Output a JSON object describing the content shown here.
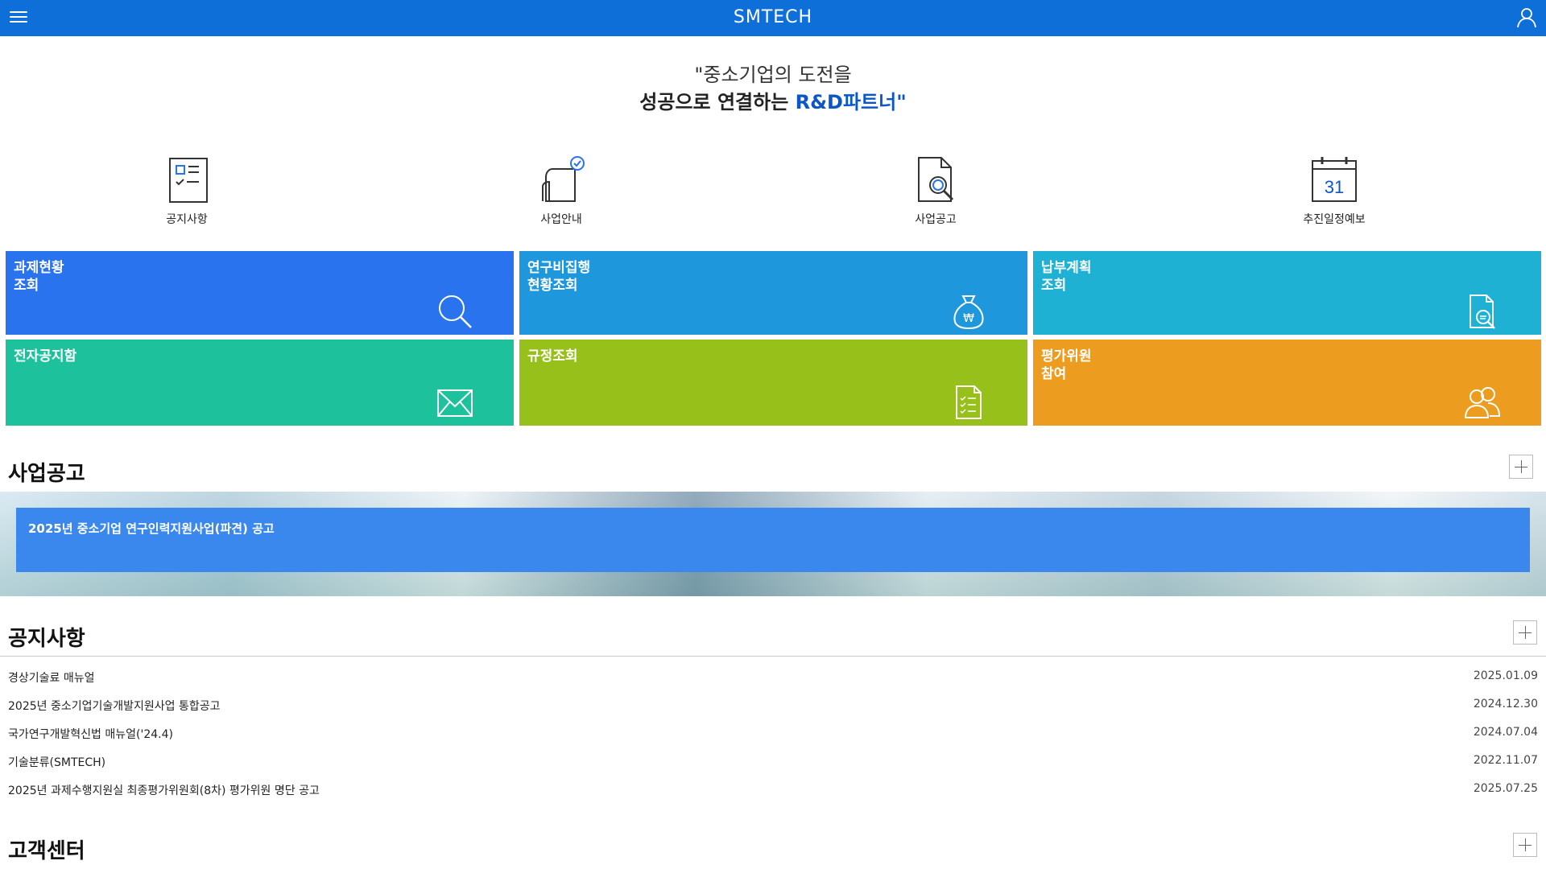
{
  "header": {
    "title": "SMTECH",
    "menu_icon": "hamburger-menu-icon",
    "user_icon": "user-icon",
    "bg_color": "#0f6fd9"
  },
  "slogan": {
    "line1": "\"중소기업의 도전을",
    "line2_prefix": "성공으로 연결하는 ",
    "line2_accent": "R&D파트너\"",
    "accent_color": "#0b57c7"
  },
  "quick_menu": [
    {
      "label": "공지사항",
      "icon": "checklist-icon"
    },
    {
      "label": "사업안내",
      "icon": "tablet-check-icon"
    },
    {
      "label": "사업공고",
      "icon": "document-search-icon"
    },
    {
      "label": "추진일정예보",
      "icon": "calendar-icon",
      "icon_text": "31"
    }
  ],
  "tiles": [
    {
      "label": "과제현황\n조회",
      "icon": "search-icon",
      "color": "#2a73ee"
    },
    {
      "label": "연구비집행\n현황조회",
      "icon": "money-bag-icon",
      "color": "#1f97dc"
    },
    {
      "label": "납부계획\n조회",
      "icon": "document-search-icon",
      "color": "#1eb1d4"
    },
    {
      "label": "전자공지함",
      "icon": "mail-icon",
      "color": "#1dc29d"
    },
    {
      "label": "규정조회",
      "icon": "checklist-document-icon",
      "color": "#97c11a"
    },
    {
      "label": "평가위원\n참여",
      "icon": "people-icon",
      "color": "#ec9c1f"
    }
  ],
  "business_notice": {
    "title": "사업공고",
    "items": [
      "2025년 중소기업 연구인력지원사업(파견) 공고"
    ]
  },
  "notices": {
    "title": "공지사항",
    "items": [
      {
        "title": "경상기술료 매뉴얼",
        "date": "2025.01.09"
      },
      {
        "title": "2025년 중소기업기술개발지원사업 통합공고",
        "date": "2024.12.30"
      },
      {
        "title": "국가연구개발혁신법 매뉴얼('24.4)",
        "date": "2024.07.04"
      },
      {
        "title": "기술분류(SMTECH)",
        "date": "2022.11.07"
      },
      {
        "title": "2025년 과제수행지원실 최종평가위원회(8차) 평가위원 명단 공고",
        "date": "2025.07.25"
      }
    ]
  },
  "customer_center": {
    "title": "고객센터"
  }
}
